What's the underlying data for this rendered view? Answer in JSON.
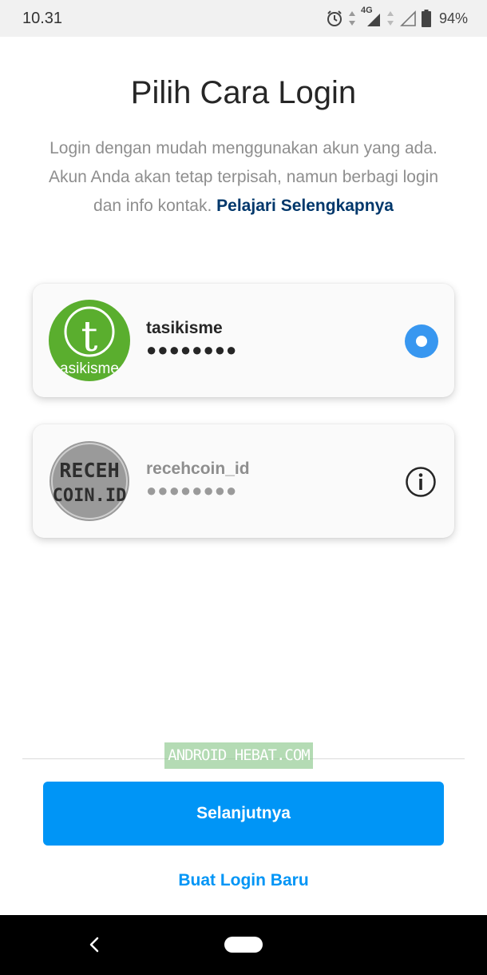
{
  "status_bar": {
    "time": "10.31",
    "network": "4G",
    "battery": "94%",
    "icons": [
      "alarm-icon",
      "data-arrows-icon",
      "signal-icon",
      "battery-icon"
    ]
  },
  "header": {
    "title": "Pilih Cara Login",
    "description": "Login dengan mudah menggunakan akun yang ada. Akun Anda akan tetap terpisah, namun berbagi login dan info kontak.",
    "learn_more": "Pelajari Selengkapnya"
  },
  "accounts": [
    {
      "username": "tasikisme",
      "password_mask": "●●●●●●●●",
      "avatar_text": "asikisme",
      "avatar_letter": "t",
      "selected": true
    },
    {
      "username": "recehcoin_id",
      "password_mask": "●●●●●●●●",
      "avatar_line1": "RECEH",
      "avatar_line2": "COIN.ID",
      "selected": false,
      "icon": "info-icon"
    }
  ],
  "watermark": "ANDROID HEBAT.COM",
  "actions": {
    "next_label": "Selanjutnya",
    "new_login_label": "Buat Login Baru"
  },
  "colors": {
    "primary": "#0095f6",
    "radio": "#3897f0",
    "link_dark": "#00376b",
    "avatar_green": "#5aae2e"
  }
}
